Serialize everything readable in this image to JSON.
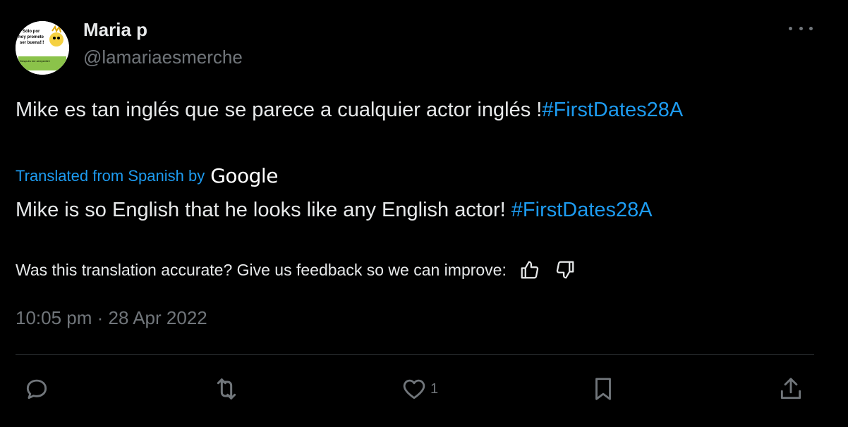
{
  "author": {
    "display_name": "Maria p",
    "handle": "@lamariaesmerche",
    "avatar_text": [
      "Sólo por",
      "hoy promete",
      "ser buena!!!",
      "Después me arrepentiré"
    ]
  },
  "tweet": {
    "original_text": "Mike es tan inglés que se parece a cualquier actor inglés !",
    "original_hashtag": "#FirstDates28A",
    "translated_from": "Translated from Spanish by",
    "translator_brand": "Google",
    "translation_text": "Mike is so English that he looks like any English actor! ",
    "translation_hashtag": "#FirstDates28A",
    "feedback_prompt": "Was this translation accurate? Give us feedback so we can improve:",
    "timestamp": "10:05 pm · 28 Apr 2022"
  },
  "actions": {
    "like_count": "1"
  },
  "icons": {
    "more": "more-icon",
    "thumbs_up": "thumbs-up-icon",
    "thumbs_down": "thumbs-down-icon",
    "reply": "reply-icon",
    "retweet": "retweet-icon",
    "like": "heart-icon",
    "bookmark": "bookmark-icon",
    "share": "share-icon"
  },
  "colors": {
    "background": "#000000",
    "text": "#e7e9ea",
    "secondary": "#71767b",
    "link": "#1d9bf0",
    "divider": "#2f3336"
  }
}
